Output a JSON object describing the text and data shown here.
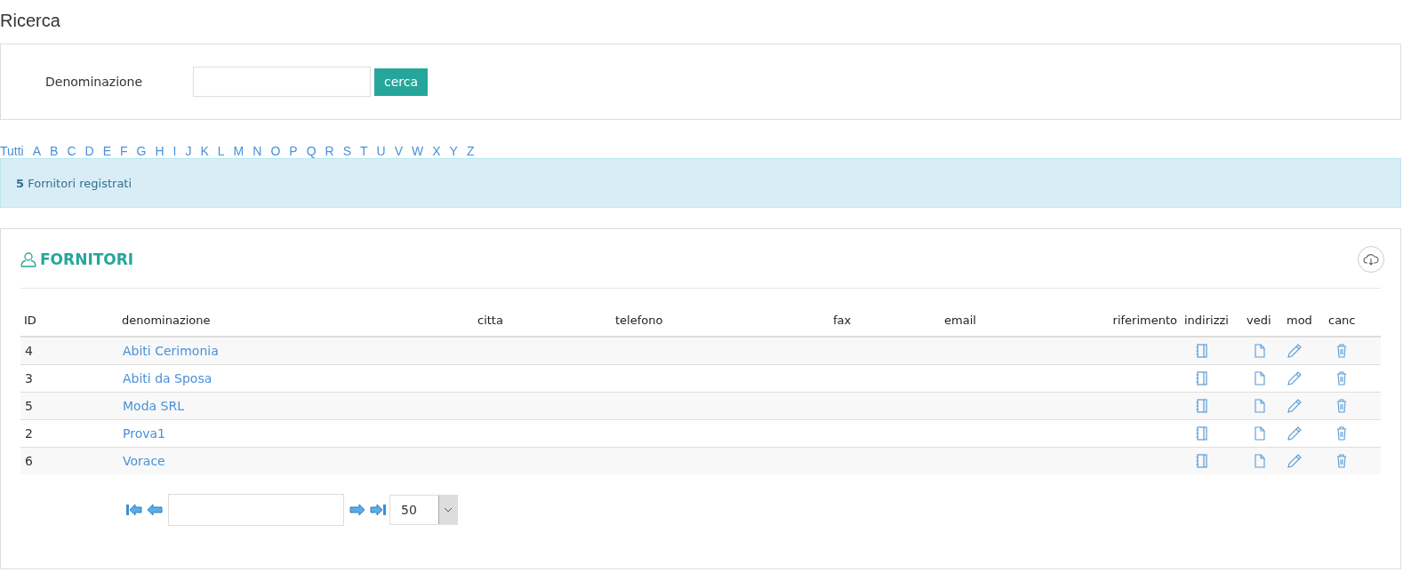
{
  "page_title": "Ricerca",
  "search": {
    "label": "Denominazione",
    "button": "cerca"
  },
  "letters": [
    "Tutti",
    "A",
    "B",
    "C",
    "D",
    "E",
    "F",
    "G",
    "H",
    "I",
    "J",
    "K",
    "L",
    "M",
    "N",
    "O",
    "P",
    "Q",
    "R",
    "S",
    "T",
    "U",
    "V",
    "W",
    "X",
    "Y",
    "Z"
  ],
  "info": {
    "count": "5",
    "text": "Fornitori registrati"
  },
  "panel": {
    "title": "FORNITORI"
  },
  "table": {
    "columns": [
      "ID",
      "denominazione",
      "citta",
      "telefono",
      "fax",
      "email",
      "riferimento",
      "indirizzi",
      "vedi",
      "mod",
      "canc"
    ],
    "rows": [
      {
        "id": "4",
        "name": "Abiti Cerimonia"
      },
      {
        "id": "3",
        "name": "Abiti da Sposa"
      },
      {
        "id": "5",
        "name": "Moda SRL"
      },
      {
        "id": "2",
        "name": "Prova1"
      },
      {
        "id": "6",
        "name": "Vorace"
      }
    ]
  },
  "pager": {
    "page_size": "50"
  }
}
